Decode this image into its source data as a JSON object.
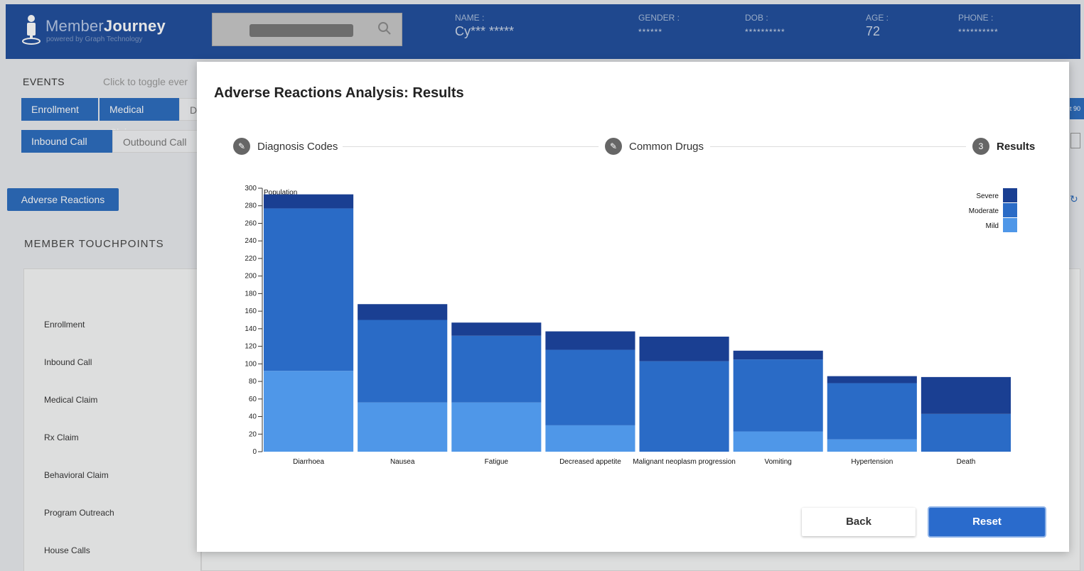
{
  "header": {
    "logo_main": "Member",
    "logo_bold": "Journey",
    "logo_sub": "powered by Graph Technology",
    "fields": [
      {
        "label": "NAME :",
        "value": "Cy*** *****",
        "big": false
      },
      {
        "label": "GENDER :",
        "value": "******",
        "big": false
      },
      {
        "label": "DOB :",
        "value": "**********",
        "big": false
      },
      {
        "label": "AGE :",
        "value": "72",
        "big": true
      },
      {
        "label": "PHONE :",
        "value": "**********",
        "big": false
      }
    ]
  },
  "events": {
    "label": "EVENTS",
    "hint": "Click to toggle ever",
    "chips_row1": [
      "Enrollment",
      "Medical Claim",
      "D"
    ],
    "chips_row2": [
      "Inbound Call",
      "Outbound Call"
    ]
  },
  "adverse_button": "Adverse Reactions",
  "touchpoints": {
    "title": "MEMBER TOUCHPOINTS",
    "rows": [
      "Enrollment",
      "Inbound Call",
      "Medical Claim",
      "Rx Claim",
      "Behavioral Claim",
      "Program Outreach",
      "House Calls"
    ]
  },
  "right_edge": {
    "chip_text": "t 90",
    "refresh_icon": "refresh-icon"
  },
  "modal": {
    "title": "Adverse Reactions Analysis: Results",
    "steps": [
      {
        "label": "Diagnosis Codes",
        "icon": "pencil-icon",
        "marker": "",
        "bold": false
      },
      {
        "label": "Common Drugs",
        "icon": "pencil-icon",
        "marker": "",
        "bold": false
      },
      {
        "label": "Results",
        "icon": "",
        "marker": "3",
        "bold": true
      }
    ],
    "back_label": "Back",
    "reset_label": "Reset"
  },
  "chart_data": {
    "type": "bar",
    "stacked": true,
    "title": "",
    "xlabel": "",
    "ylabel": "Population",
    "ylim": [
      0,
      300
    ],
    "yticks": [
      0,
      20,
      40,
      60,
      80,
      100,
      120,
      140,
      160,
      180,
      200,
      220,
      240,
      260,
      280,
      300
    ],
    "categories": [
      "Diarrhoea",
      "Nausea",
      "Fatigue",
      "Decreased appetite",
      "Malignant neoplasm progression",
      "Vomiting",
      "Hypertension",
      "Death"
    ],
    "series": [
      {
        "name": "Mild",
        "color": "#4f97e8",
        "values": [
          92,
          56,
          56,
          30,
          0,
          23,
          14,
          0
        ]
      },
      {
        "name": "Moderate",
        "color": "#2a6bc6",
        "values": [
          185,
          94,
          76,
          86,
          103,
          82,
          64,
          43
        ]
      },
      {
        "name": "Severe",
        "color": "#1a3f92",
        "values": [
          16,
          18,
          15,
          21,
          28,
          10,
          8,
          42
        ]
      }
    ],
    "legend": {
      "position": "top-right",
      "order": [
        "Severe",
        "Moderate",
        "Mild"
      ]
    },
    "grid": false
  },
  "colors": {
    "header_bg": "#1e4d9c",
    "accent": "#2a6bbf",
    "mild": "#4f97e8",
    "moderate": "#2a6bc6",
    "severe": "#1a3f92"
  }
}
